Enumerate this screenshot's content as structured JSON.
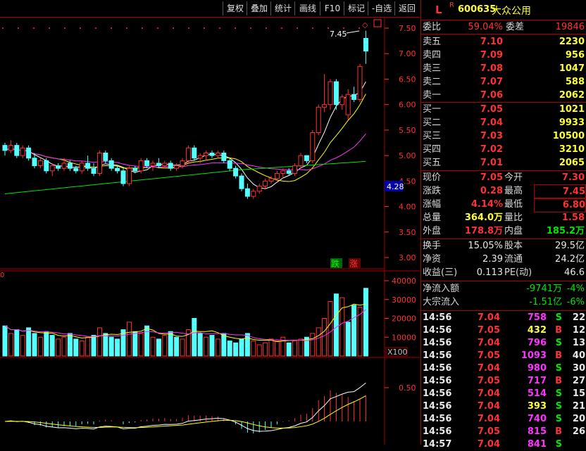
{
  "toolbar": {
    "buttons": [
      "复权",
      "叠加",
      "统计",
      "画线",
      "F10",
      "标记",
      "-自选",
      "返回"
    ]
  },
  "price_axis": [
    "7.50",
    "7.00",
    "6.50",
    "6.00",
    "5.50",
    "5.00",
    "4.50",
    "4.00",
    "3.50",
    "3.00"
  ],
  "current_price_marker": "4.28",
  "high_annotation": "7.45",
  "down_tag": "跌",
  "up_tag": "涨",
  "vol_axis": [
    "40000",
    "30000",
    "20000",
    "10000"
  ],
  "vol_unit": "X100",
  "vol_zero": "0",
  "macd_axis": "0.50",
  "stock": {
    "flag": "L",
    "r": "R",
    "code": "600635",
    "name": "大众公用"
  },
  "webi": {
    "label1": "委比",
    "val1": "59.04%",
    "label2": "委差",
    "val2": "19846"
  },
  "asks": [
    {
      "label": "卖五",
      "price": "7.10",
      "vol": "2230"
    },
    {
      "label": "卖四",
      "price": "7.09",
      "vol": "956"
    },
    {
      "label": "卖三",
      "price": "7.08",
      "vol": "1047"
    },
    {
      "label": "卖二",
      "price": "7.07",
      "vol": "588"
    },
    {
      "label": "卖一",
      "price": "7.06",
      "vol": "2062"
    }
  ],
  "bids": [
    {
      "label": "买一",
      "price": "7.05",
      "vol": "1021"
    },
    {
      "label": "买二",
      "price": "7.04",
      "vol": "9933"
    },
    {
      "label": "买三",
      "price": "7.03",
      "vol": "10500"
    },
    {
      "label": "买四",
      "price": "7.02",
      "vol": "3210"
    },
    {
      "label": "买五",
      "price": "7.01",
      "vol": "2065"
    }
  ],
  "quote": [
    {
      "l1": "现价",
      "v1": "7.05",
      "l2": "今开",
      "v2": "7.30",
      "c1": "red",
      "c2": "red"
    },
    {
      "l1": "涨跌",
      "v1": "0.28",
      "l2": "最高",
      "v2": "7.45",
      "c1": "red",
      "c2": "red"
    },
    {
      "l1": "涨幅",
      "v1": "4.14%",
      "l2": "最低",
      "v2": "6.80",
      "c1": "red",
      "c2": "red"
    },
    {
      "l1": "总量",
      "v1": "364.0万",
      "l2": "量比",
      "v2": "1.58",
      "c1": "yellow",
      "c2": "red"
    },
    {
      "l1": "外盘",
      "v1": "178.8万",
      "l2": "内盘",
      "v2": "185.2万",
      "c1": "red",
      "c2": "green"
    }
  ],
  "extra": [
    {
      "l1": "换手",
      "v1": "15.05%",
      "l2": "股本",
      "v2": "29.5亿"
    },
    {
      "l1": "净资",
      "v1": "2.39",
      "l2": "流通",
      "v2": "24.2亿"
    },
    {
      "l1": "收益(三)",
      "v1": "0.113",
      "l2": "PE(动)",
      "v2": "46.6"
    }
  ],
  "flows": [
    {
      "label": "净流入额",
      "value": "-9741万",
      "pct": "-4%"
    },
    {
      "label": "大宗流入",
      "value": "-1.51亿",
      "pct": "-6%"
    }
  ],
  "ticks": [
    {
      "time": "14:56",
      "price": "7.04",
      "vol": "758",
      "side": "S",
      "n": "22",
      "vc": "purple"
    },
    {
      "time": "14:56",
      "price": "7.05",
      "vol": "432",
      "side": "B",
      "n": "12",
      "vc": "yellow"
    },
    {
      "time": "14:56",
      "price": "7.04",
      "vol": "796",
      "side": "S",
      "n": "13",
      "vc": "purple"
    },
    {
      "time": "14:56",
      "price": "7.05",
      "vol": "1093",
      "side": "B",
      "n": "40",
      "vc": "purple"
    },
    {
      "time": "14:56",
      "price": "7.04",
      "vol": "980",
      "side": "S",
      "n": "30",
      "vc": "purple"
    },
    {
      "time": "14:56",
      "price": "7.05",
      "vol": "717",
      "side": "B",
      "n": "27",
      "vc": "purple"
    },
    {
      "time": "14:56",
      "price": "7.04",
      "vol": "514",
      "side": "S",
      "n": "15",
      "vc": "purple"
    },
    {
      "time": "14:56",
      "price": "7.04",
      "vol": "393",
      "side": "S",
      "n": "21",
      "vc": "yellow"
    },
    {
      "time": "14:56",
      "price": "7.04",
      "vol": "740",
      "side": "S",
      "n": "20",
      "vc": "purple"
    },
    {
      "time": "14:56",
      "price": "7.05",
      "vol": "815",
      "side": "B",
      "n": "26",
      "vc": "purple"
    },
    {
      "time": "14:57",
      "price": "7.04",
      "vol": "841",
      "side": "S",
      "n": "",
      "vc": "purple"
    }
  ],
  "colors": {
    "up": "#ff3232",
    "down": "#54ffff",
    "ma5": "#ffffff",
    "ma10": "#ffff00",
    "ma20": "#ff33ff",
    "ma60": "#00e600",
    "frame": "#aa0000"
  },
  "candles": [
    [
      5.2,
      5.25,
      5.0,
      5.1
    ],
    [
      5.1,
      5.3,
      5.05,
      5.2
    ],
    [
      5.2,
      5.25,
      4.95,
      5.0
    ],
    [
      5.0,
      5.2,
      4.95,
      5.15
    ],
    [
      5.15,
      5.2,
      4.9,
      4.95
    ],
    [
      4.95,
      5.05,
      4.75,
      4.8
    ],
    [
      4.8,
      4.95,
      4.75,
      4.9
    ],
    [
      4.9,
      4.95,
      4.65,
      4.7
    ],
    [
      4.7,
      4.85,
      4.6,
      4.8
    ],
    [
      4.8,
      4.85,
      4.7,
      4.75
    ],
    [
      4.75,
      4.95,
      4.7,
      4.85
    ],
    [
      4.85,
      4.9,
      4.7,
      4.75
    ],
    [
      4.75,
      4.8,
      4.65,
      4.7
    ],
    [
      4.7,
      4.9,
      4.65,
      4.85
    ],
    [
      4.85,
      5.0,
      4.7,
      4.75
    ],
    [
      4.75,
      4.85,
      4.6,
      4.65
    ],
    [
      4.65,
      5.1,
      4.6,
      5.05
    ],
    [
      5.05,
      5.1,
      4.85,
      4.9
    ],
    [
      4.9,
      4.95,
      4.7,
      4.75
    ],
    [
      4.75,
      4.8,
      4.65,
      4.7
    ],
    [
      4.7,
      4.75,
      4.4,
      4.45
    ],
    [
      4.45,
      4.8,
      4.4,
      4.75
    ],
    [
      4.75,
      4.8,
      4.65,
      4.7
    ],
    [
      4.7,
      4.95,
      4.65,
      4.9
    ],
    [
      4.9,
      4.95,
      4.75,
      4.8
    ],
    [
      4.8,
      4.9,
      4.7,
      4.85
    ],
    [
      4.85,
      4.95,
      4.75,
      4.8
    ],
    [
      4.8,
      4.9,
      4.75,
      4.85
    ],
    [
      4.85,
      4.9,
      4.7,
      4.75
    ],
    [
      4.75,
      4.85,
      4.7,
      4.8
    ],
    [
      4.8,
      4.95,
      4.75,
      4.9
    ],
    [
      4.9,
      5.2,
      4.85,
      5.15
    ],
    [
      5.15,
      5.2,
      4.9,
      4.95
    ],
    [
      4.95,
      5.05,
      4.85,
      5.0
    ],
    [
      5.0,
      5.1,
      4.9,
      5.05
    ],
    [
      5.05,
      5.1,
      4.95,
      5.0
    ],
    [
      5.0,
      5.1,
      4.95,
      5.05
    ],
    [
      5.05,
      5.1,
      4.85,
      4.9
    ],
    [
      4.9,
      4.95,
      4.7,
      4.75
    ],
    [
      4.75,
      4.8,
      4.55,
      4.6
    ],
    [
      4.6,
      4.65,
      4.3,
      4.35
    ],
    [
      4.35,
      4.45,
      4.15,
      4.2
    ],
    [
      4.2,
      4.35,
      4.15,
      4.3
    ],
    [
      4.3,
      4.45,
      4.25,
      4.4
    ],
    [
      4.4,
      4.55,
      4.35,
      4.5
    ],
    [
      4.5,
      4.6,
      4.45,
      4.55
    ],
    [
      4.55,
      4.7,
      4.5,
      4.65
    ],
    [
      4.65,
      4.75,
      4.55,
      4.7
    ],
    [
      4.7,
      4.75,
      4.6,
      4.65
    ],
    [
      4.65,
      4.85,
      4.6,
      4.8
    ],
    [
      4.8,
      5.05,
      4.75,
      5.0
    ],
    [
      5.0,
      5.0,
      4.85,
      4.9
    ],
    [
      4.9,
      5.5,
      4.85,
      5.45
    ],
    [
      5.45,
      6.0,
      5.4,
      5.95
    ],
    [
      5.95,
      6.6,
      5.85,
      6.0
    ],
    [
      6.0,
      6.5,
      5.9,
      6.45
    ],
    [
      6.45,
      6.5,
      5.9,
      6.0
    ],
    [
      6.0,
      6.2,
      5.9,
      6.15
    ],
    [
      5.8,
      6.3,
      5.7,
      6.2
    ],
    [
      6.2,
      6.35,
      6.05,
      6.1
    ],
    [
      6.1,
      6.8,
      6.05,
      6.75
    ],
    [
      7.3,
      7.45,
      6.8,
      7.05
    ]
  ],
  "volumes": [
    [
      16000,
      1
    ],
    [
      12000,
      0
    ],
    [
      14000,
      1
    ],
    [
      11000,
      0
    ],
    [
      15000,
      1
    ],
    [
      12000,
      1
    ],
    [
      10000,
      0
    ],
    [
      13000,
      1
    ],
    [
      11000,
      1
    ],
    [
      9000,
      0
    ],
    [
      10000,
      0
    ],
    [
      12000,
      1
    ],
    [
      9000,
      1
    ],
    [
      8000,
      0
    ],
    [
      10000,
      0
    ],
    [
      11000,
      1
    ],
    [
      15000,
      0
    ],
    [
      12000,
      1
    ],
    [
      10000,
      1
    ],
    [
      9000,
      1
    ],
    [
      14000,
      1
    ],
    [
      18000,
      0
    ],
    [
      13000,
      1
    ],
    [
      12000,
      0
    ],
    [
      16000,
      1
    ],
    [
      10000,
      0
    ],
    [
      9000,
      1
    ],
    [
      11000,
      0
    ],
    [
      13000,
      1
    ],
    [
      10000,
      1
    ],
    [
      9000,
      0
    ],
    [
      14000,
      0
    ],
    [
      20000,
      1
    ],
    [
      12000,
      1
    ],
    [
      10000,
      0
    ],
    [
      11000,
      1
    ],
    [
      9000,
      0
    ],
    [
      12000,
      1
    ],
    [
      8000,
      1
    ],
    [
      7000,
      1
    ],
    [
      9000,
      1
    ],
    [
      12000,
      1
    ],
    [
      8000,
      0
    ],
    [
      6000,
      0
    ],
    [
      7000,
      0
    ],
    [
      9000,
      0
    ],
    [
      8000,
      0
    ],
    [
      10000,
      0
    ],
    [
      7000,
      1
    ],
    [
      8000,
      0
    ],
    [
      9000,
      0
    ],
    [
      10000,
      1
    ],
    [
      12000,
      0
    ],
    [
      15000,
      0
    ],
    [
      20000,
      0
    ],
    [
      29000,
      0
    ],
    [
      33000,
      1
    ],
    [
      31000,
      0
    ],
    [
      18000,
      1
    ],
    [
      27000,
      1
    ],
    [
      26000,
      0
    ],
    [
      36000,
      1
    ]
  ]
}
